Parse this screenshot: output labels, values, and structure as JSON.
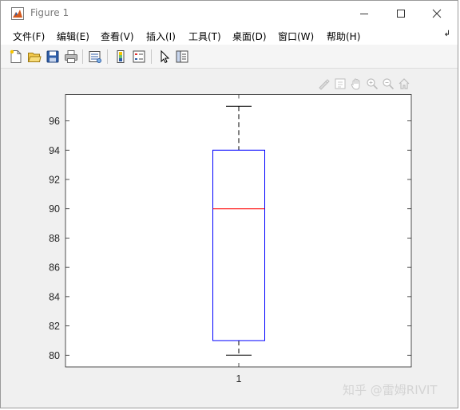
{
  "window": {
    "title": "Figure 1"
  },
  "menu": [
    {
      "label": "文件(F)"
    },
    {
      "label": "编辑(E)"
    },
    {
      "label": "查看(V)"
    },
    {
      "label": "插入(I)"
    },
    {
      "label": "工具(T)"
    },
    {
      "label": "桌面(D)"
    },
    {
      "label": "窗口(W)"
    },
    {
      "label": "帮助(H)"
    }
  ],
  "toolbar": {
    "buttons": [
      "new-figure-icon",
      "open-file-icon",
      "save-icon",
      "print-icon",
      "link-plot-icon",
      "insert-colorbar-icon",
      "insert-legend-icon",
      "edit-plot-icon",
      "property-inspector-icon"
    ]
  },
  "axes_toolbar": [
    "brush-icon",
    "data-tips-icon",
    "pan-icon",
    "zoom-in-icon",
    "zoom-out-icon",
    "home-icon"
  ],
  "chart_data": {
    "type": "box",
    "categories": [
      "1"
    ],
    "box": {
      "min": 80,
      "q1": 81,
      "median": 90,
      "q3": 94,
      "max": 97
    },
    "ylim": [
      79.2,
      97.8
    ],
    "yticks": [
      80,
      82,
      84,
      86,
      88,
      90,
      92,
      94,
      96
    ],
    "colors": {
      "box": "#0000ff",
      "median": "#ff0000",
      "whisker": "#000000"
    }
  },
  "watermark": "知乎 @雷姆RIVIT"
}
